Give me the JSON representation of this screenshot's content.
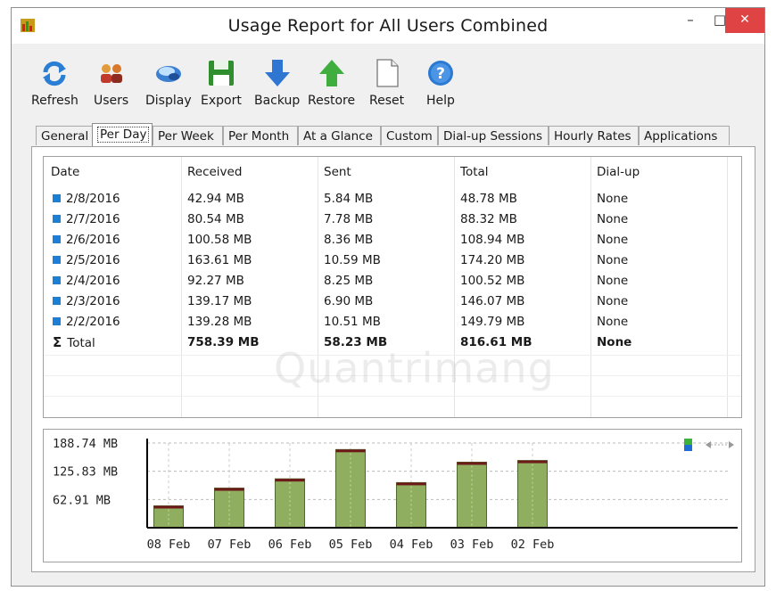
{
  "window": {
    "title": "Usage Report for All Users Combined",
    "min_symbol": "–",
    "max_symbol": "□",
    "close_symbol": "✕"
  },
  "toolbar": [
    {
      "label": "Refresh",
      "icon": "refresh-icon"
    },
    {
      "label": "Users",
      "icon": "users-icon"
    },
    {
      "label": "Display",
      "icon": "display-icon"
    },
    {
      "label": "Export",
      "icon": "export-icon"
    },
    {
      "label": "Backup",
      "icon": "backup-icon"
    },
    {
      "label": "Restore",
      "icon": "restore-icon"
    },
    {
      "label": "Reset",
      "icon": "reset-icon"
    },
    {
      "label": "Help",
      "icon": "help-icon"
    }
  ],
  "tabs": [
    "General",
    "Per Day",
    "Per Week",
    "Per Month",
    "At a Glance",
    "Custom",
    "Dial-up Sessions",
    "Hourly Rates",
    "Applications"
  ],
  "active_tab": "Per Day",
  "table": {
    "columns": [
      "Date",
      "Received",
      "Sent",
      "Total",
      "Dial-up"
    ],
    "rows": [
      [
        "2/8/2016",
        "42.94 MB",
        "5.84 MB",
        "48.78 MB",
        "None"
      ],
      [
        "2/7/2016",
        "80.54 MB",
        "7.78 MB",
        "88.32 MB",
        "None"
      ],
      [
        "2/6/2016",
        "100.58 MB",
        "8.36 MB",
        "108.94 MB",
        "None"
      ],
      [
        "2/5/2016",
        "163.61 MB",
        "10.59 MB",
        "174.20 MB",
        "None"
      ],
      [
        "2/4/2016",
        "92.27 MB",
        "8.25 MB",
        "100.52 MB",
        "None"
      ],
      [
        "2/3/2016",
        "139.17 MB",
        "6.90 MB",
        "146.07 MB",
        "None"
      ],
      [
        "2/2/2016",
        "139.28 MB",
        "10.51 MB",
        "149.79 MB",
        "None"
      ]
    ],
    "total_symbol": "Σ",
    "total": [
      "Total",
      "758.39 MB",
      "58.23 MB",
      "816.61 MB",
      "None"
    ]
  },
  "watermark": "Quantrimang",
  "colors": {
    "row_marker": "#1d7ed6",
    "bar_fill": "#8fae5f",
    "bar_top": "#6e1a1a",
    "close_button": "#e04343"
  },
  "chart_data": {
    "type": "bar",
    "categories": [
      "08 Feb",
      "07 Feb",
      "06 Feb",
      "05 Feb",
      "04 Feb",
      "03 Feb",
      "02 Feb"
    ],
    "series": [
      {
        "values": [
          48.78,
          88.32,
          108.94,
          174.2,
          100.52,
          146.07,
          149.79
        ]
      }
    ],
    "y_tick_labels": [
      "188.74 MB",
      "125.83 MB",
      "62.91 MB"
    ],
    "y_ticks": [
      188.74,
      125.83,
      62.91
    ],
    "ylim": [
      0,
      188.74
    ],
    "grid": true
  }
}
